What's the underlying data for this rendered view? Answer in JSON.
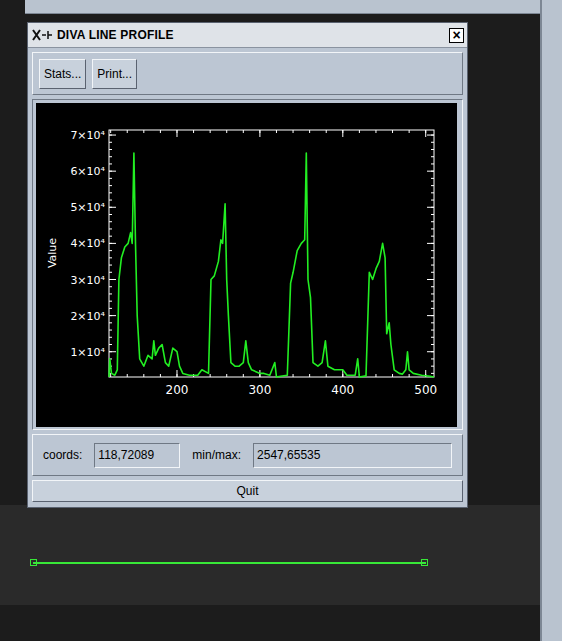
{
  "window": {
    "title": "DIVA LINE PROFILE",
    "close": "×"
  },
  "toolbar": [
    "Stats...",
    "Print..."
  ],
  "chart": {
    "y_label": "Value",
    "y_ticks": [
      "1×10⁴",
      "2×10⁴",
      "3×10⁴",
      "4×10⁴",
      "5×10⁴",
      "6×10⁴",
      "7×10⁴"
    ],
    "y_tick_values": [
      10000,
      20000,
      30000,
      40000,
      50000,
      60000,
      70000
    ],
    "x_ticks": [
      "200",
      "300",
      "400",
      "500"
    ],
    "x_tick_values": [
      200,
      300,
      400,
      500
    ],
    "x_range": [
      118,
      510
    ],
    "y_range": [
      3000,
      71400
    ],
    "series": [
      {
        "x": [
          118,
          119,
          121,
          125,
          128,
          130,
          133,
          137,
          141,
          144,
          146,
          148,
          150,
          152,
          155,
          160,
          165,
          170,
          172,
          174,
          178,
          182,
          186,
          190,
          195,
          200,
          203,
          207,
          215,
          225,
          230,
          238,
          241,
          245,
          250,
          253,
          255,
          258,
          260,
          262,
          265,
          270,
          275,
          280,
          283,
          286,
          290,
          300,
          305,
          312,
          318,
          320,
          325,
          333,
          337,
          340,
          345,
          350,
          354,
          356,
          358,
          361,
          364,
          370,
          375,
          379,
          382,
          390,
          400,
          405,
          415,
          418,
          420,
          428,
          432,
          436,
          440,
          444,
          448,
          451,
          453,
          456,
          458,
          462,
          468,
          472,
          476,
          478,
          480,
          485,
          495,
          505,
          510
        ],
        "y": [
          3000,
          8000,
          4000,
          3500,
          5000,
          30000,
          36000,
          39000,
          40000,
          43000,
          40000,
          65000,
          40000,
          20000,
          8000,
          6000,
          9000,
          8000,
          13000,
          9000,
          11000,
          12000,
          7000,
          6000,
          11000,
          10000,
          6000,
          4000,
          3500,
          3500,
          5000,
          4000,
          30000,
          31000,
          35000,
          41000,
          40000,
          51000,
          30000,
          20000,
          7000,
          6000,
          6000,
          7000,
          13000,
          7000,
          5000,
          4000,
          4000,
          3500,
          7000,
          3000,
          3200,
          3500,
          29000,
          32000,
          38000,
          40000,
          41000,
          65000,
          30000,
          25000,
          7000,
          6000,
          7000,
          13000,
          6000,
          5000,
          5000,
          3500,
          3500,
          8000,
          3000,
          3300,
          32000,
          30000,
          33000,
          35000,
          40000,
          36000,
          15000,
          18000,
          12000,
          5000,
          4000,
          3800,
          5000,
          10000,
          5000,
          4000,
          3500,
          3200,
          3000
        ]
      }
    ]
  },
  "fields": [
    {
      "label": "coords:",
      "value": "118,72089"
    },
    {
      "label": "min/max:",
      "value": "2547,65535"
    }
  ],
  "quit": "Quit"
}
